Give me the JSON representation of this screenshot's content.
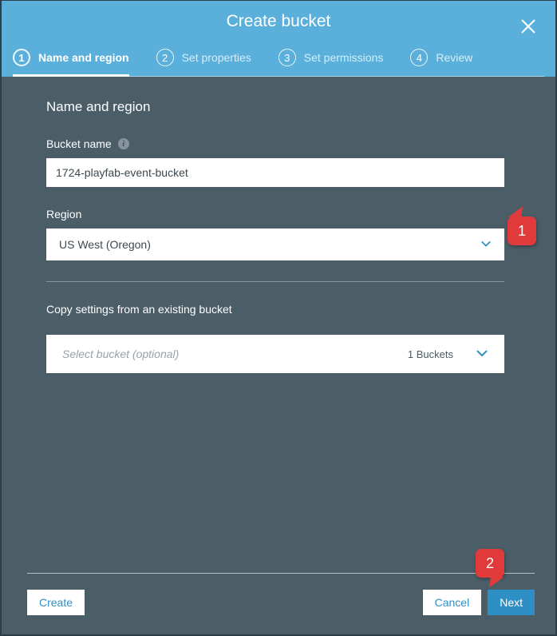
{
  "header": {
    "title": "Create bucket",
    "steps": [
      {
        "num": "1",
        "label": "Name and region"
      },
      {
        "num": "2",
        "label": "Set properties"
      },
      {
        "num": "3",
        "label": "Set permissions"
      },
      {
        "num": "4",
        "label": "Review"
      }
    ]
  },
  "section": {
    "title": "Name and region",
    "bucket_label": "Bucket name",
    "bucket_value": "1724-playfab-event-bucket",
    "region_label": "Region",
    "region_value": "US West (Oregon)",
    "copy_label": "Copy settings from an existing bucket",
    "copy_placeholder": "Select bucket (optional)",
    "copy_count": "1 Buckets"
  },
  "footer": {
    "create": "Create",
    "cancel": "Cancel",
    "next": "Next"
  },
  "callouts": {
    "c1": "1",
    "c2": "2"
  }
}
